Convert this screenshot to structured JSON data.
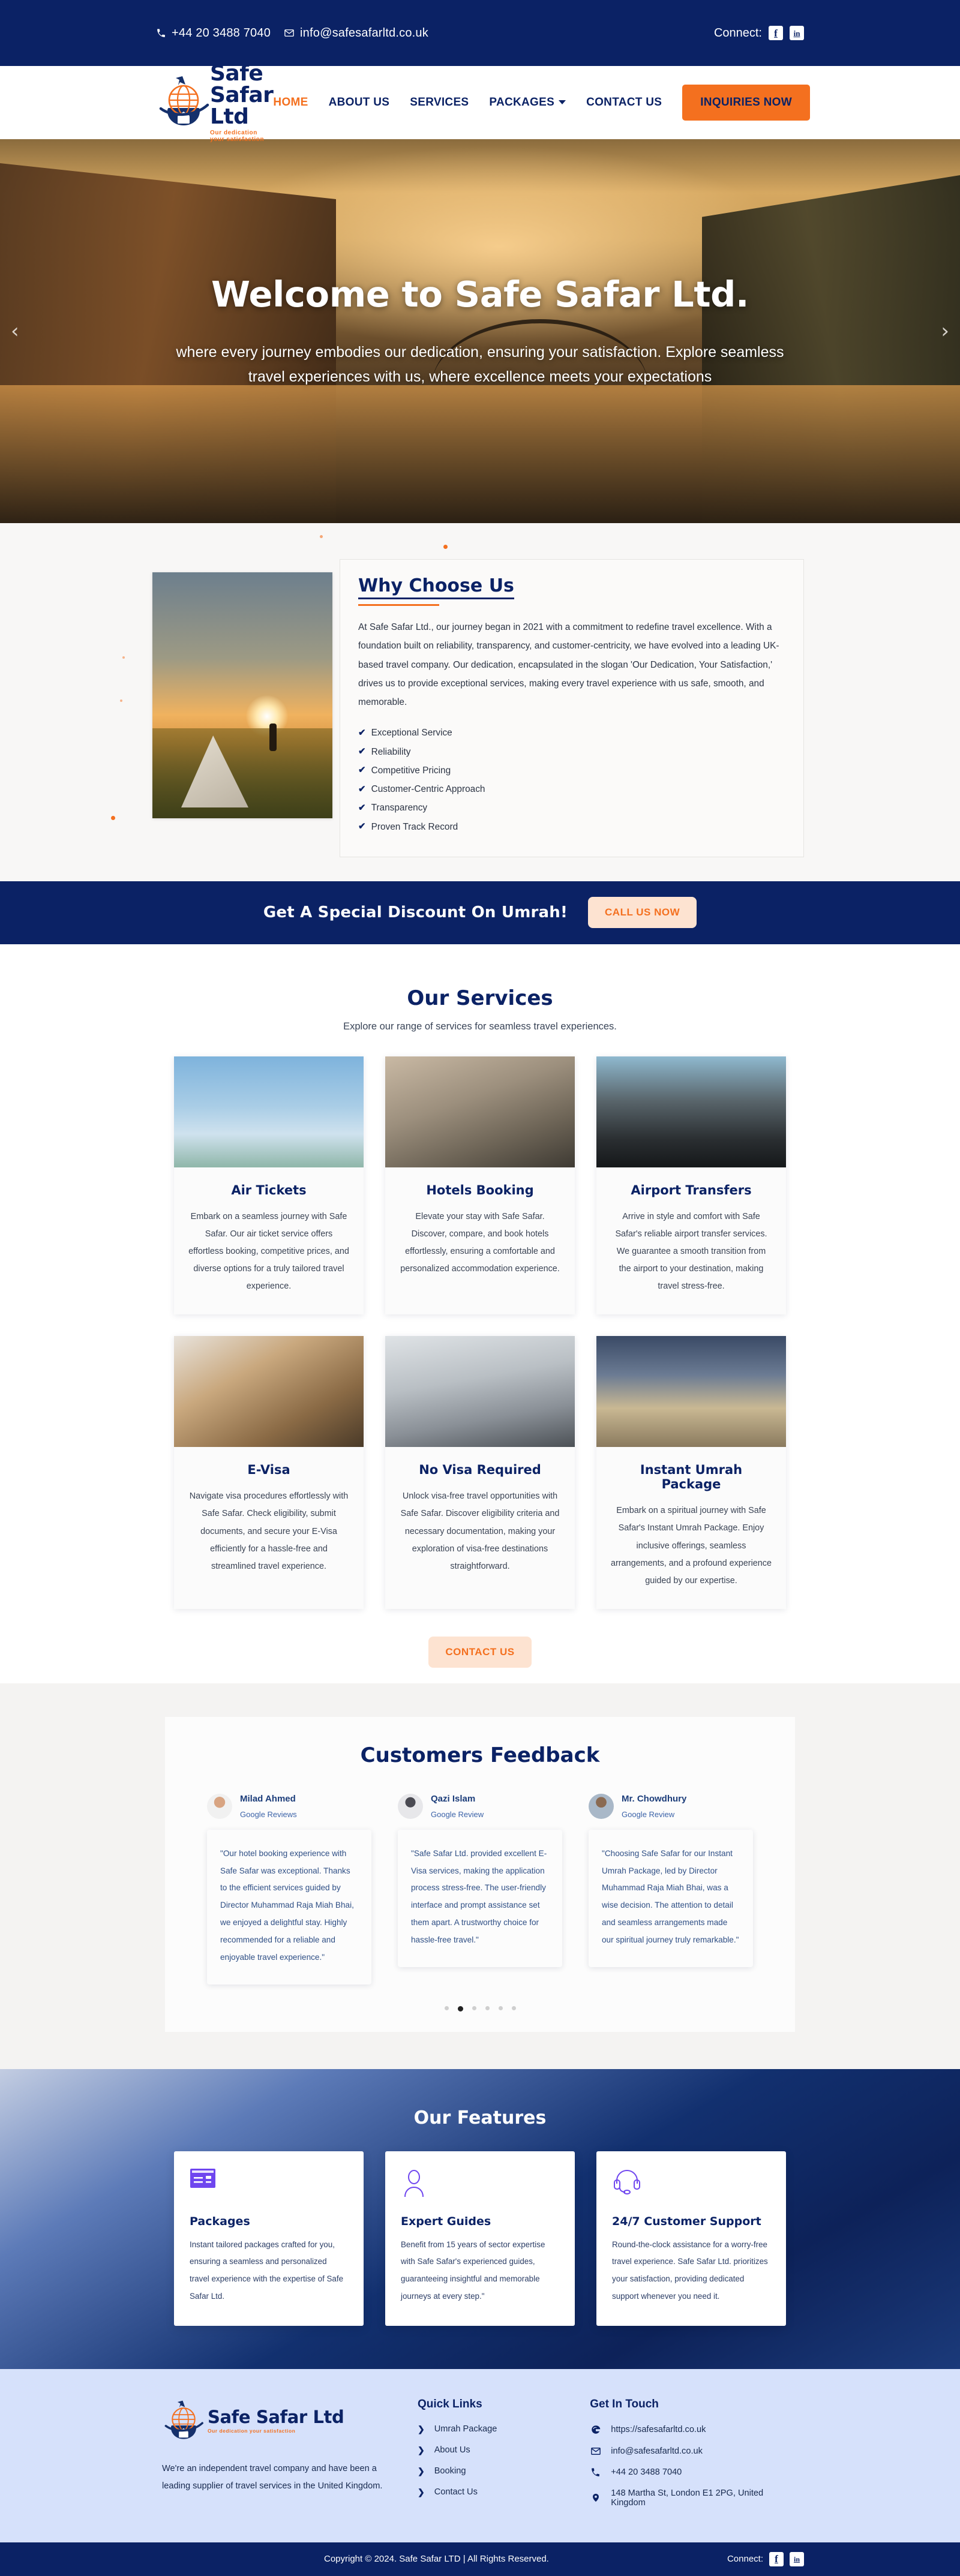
{
  "topbar": {
    "phone": "+44 20 3488 7040",
    "email": "info@safesafarltd.co.uk",
    "connect_label": "Connect:",
    "facebook": "f",
    "linkedin": "in"
  },
  "brand": {
    "name": "Safe Safar Ltd",
    "tagline": "Our dedication your satisfaction"
  },
  "nav": {
    "items": [
      {
        "label": "HOME",
        "active": true
      },
      {
        "label": "ABOUT US",
        "active": false
      },
      {
        "label": "SERVICES",
        "active": false
      },
      {
        "label": "PACKAGES",
        "active": false,
        "caret": true
      },
      {
        "label": "CONTACT US",
        "active": false
      }
    ],
    "cta": "INQUIRIES NOW"
  },
  "hero": {
    "title": "Welcome to Safe Safar Ltd.",
    "subtitle": "where every journey embodies our dedication, ensuring your satisfaction. Explore seamless travel experiences with us, where excellence meets your expectations",
    "prev": "‹",
    "next": "›"
  },
  "why": {
    "title": "Why Choose Us",
    "body": "At Safe Safar Ltd., our journey began in 2021 with a commitment to redefine travel excellence. With a foundation built on reliability, transparency, and customer-centricity, we have evolved into a leading UK-based travel company. Our dedication, encapsulated in the slogan 'Our Dedication, Your Satisfaction,' drives us to provide exceptional services, making every travel experience with us safe, smooth, and memorable.",
    "tick": "✔",
    "points": [
      "Exceptional Service",
      "Reliability",
      "Competitive Pricing",
      "Customer-Centric Approach",
      "Transparency",
      "Proven Track Record"
    ]
  },
  "strip": {
    "text": "Get A Special Discount On Umrah!",
    "cta": "CALL US NOW"
  },
  "services": {
    "title": "Our Services",
    "subtitle": "Explore our range of services for seamless travel experiences.",
    "cta": "CONTACT US",
    "items": [
      {
        "title": "Air Tickets",
        "desc": "Embark on a seamless journey with Safe Safar. Our air ticket service offers effortless booking, competitive prices, and diverse options for a truly tailored travel experience."
      },
      {
        "title": "Hotels Booking",
        "desc": "Elevate your stay with Safe Safar. Discover, compare, and book hotels effortlessly, ensuring a comfortable and personalized accommodation experience."
      },
      {
        "title": "Airport Transfers",
        "desc": "Arrive in style and comfort with Safe Safar's reliable airport transfer services. We guarantee a smooth transition from the airport to your destination, making travel stress-free."
      },
      {
        "title": "E-Visa",
        "desc": "Navigate visa procedures effortlessly with Safe Safar. Check eligibility, submit documents, and secure your E-Visa efficiently for a hassle-free and streamlined travel experience."
      },
      {
        "title": "No Visa Required",
        "desc": "Unlock visa-free travel opportunities with Safe Safar. Discover eligibility criteria and necessary documentation, making your exploration of visa-free destinations straightforward."
      },
      {
        "title": "Instant Umrah Package",
        "desc": "Embark on a spiritual journey with Safe Safar's Instant Umrah Package. Enjoy inclusive offerings, seamless arrangements, and a profound experience guided by our expertise."
      }
    ]
  },
  "feedback": {
    "title": "Customers Feedback",
    "items": [
      {
        "name": "Milad Ahmed",
        "source": "Google Reviews",
        "quote": "\"Our hotel booking experience with Safe Safar was exceptional. Thanks to the efficient services guided by Director Muhammad Raja Miah Bhai, we enjoyed a delightful stay. Highly recommended for a reliable and enjoyable travel experience.\""
      },
      {
        "name": "Qazi Islam",
        "source": "Google Review",
        "quote": "\"Safe Safar Ltd. provided excellent E-Visa services, making the application process stress-free. The user-friendly interface and prompt assistance set them apart. A trustworthy choice for hassle-free travel.\""
      },
      {
        "name": "Mr. Chowdhury",
        "source": "Google Review",
        "quote": "\"Choosing Safe Safar for our Instant Umrah Package, led by Director Muhammad Raja Miah Bhai, was a wise decision. The attention to detail and seamless arrangements made our spiritual journey truly remarkable.\""
      }
    ],
    "dots_total": 6,
    "dots_active_index": 1
  },
  "features": {
    "title": "Our Features",
    "items": [
      {
        "icon": "card-icon",
        "title": "Packages",
        "desc": "Instant tailored packages crafted for you, ensuring a seamless and personalized travel experience with the expertise of Safe Safar Ltd."
      },
      {
        "icon": "guide-person-icon",
        "title": "Expert Guides",
        "desc": "Benefit from 15 years of sector expertise with Safe Safar's experienced guides, guaranteeing insightful and memorable journeys at every step.\""
      },
      {
        "icon": "headset-icon",
        "title": "24/7 Customer Support",
        "desc": "Round-the-clock assistance for a worry-free travel experience. Safe Safar Ltd. prioritizes your satisfaction, providing dedicated support whenever you need it."
      }
    ]
  },
  "footer": {
    "about": "We're an independent travel company and have been a leading supplier of travel services in the United Kingdom.",
    "quick_links_title": "Quick Links",
    "quick_links": [
      "Umrah Package",
      "About Us",
      "Booking",
      "Contact Us"
    ],
    "chevron": "❯",
    "get_in_touch_title": "Get In Touch",
    "contacts": [
      {
        "icon": "globe-browser-icon",
        "text": "https://safesafarltd.co.uk"
      },
      {
        "icon": "envelope-icon",
        "text": "info@safesafarltd.co.uk"
      },
      {
        "icon": "phone-icon",
        "text": "+44 20 3488 7040"
      },
      {
        "icon": "location-pin-icon",
        "text": "148 Martha St, London E1 2PG, United Kingdom"
      }
    ]
  },
  "copyright": {
    "text": "Copyright © 2024. Safe Safar LTD | All Rights Reserved.",
    "connect_label": "Connect:",
    "facebook": "f",
    "linkedin": "in"
  },
  "colors": {
    "navy": "#0b2265",
    "orange": "#f4701f",
    "footer_bg": "#d6e1fb",
    "purple": "#6f46ef"
  }
}
